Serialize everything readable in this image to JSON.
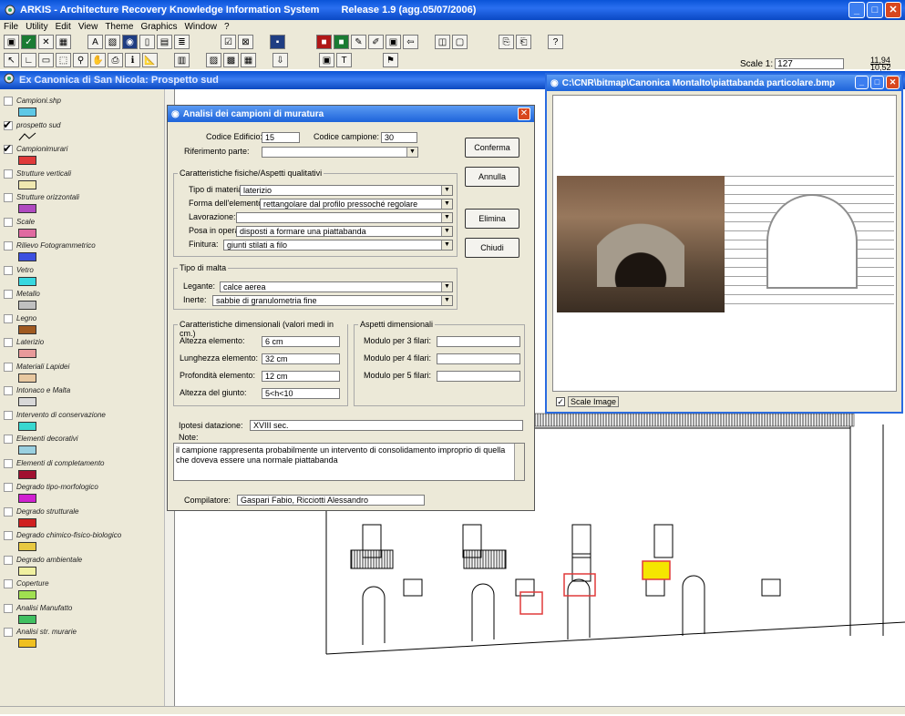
{
  "app": {
    "title": "ARKIS - Architecture Recovery Knowledge Information System",
    "release": "Release 1.9  (agg.05/07/2006)"
  },
  "menu": [
    "File",
    "Utility",
    "Edit",
    "View",
    "Theme",
    "Graphics",
    "Window",
    "?"
  ],
  "scale": {
    "label": "Scale 1:",
    "value": "127"
  },
  "coords": {
    "x": "11,94",
    "y": "10,52"
  },
  "map_window": {
    "title": "Ex Canonica di San Nicola: Prospetto sud"
  },
  "layers": [
    {
      "name": "Campioni.shp",
      "checked": false,
      "color": "#5ec8e6"
    },
    {
      "name": "prospetto sud",
      "checked": true,
      "color": "line"
    },
    {
      "name": "Campionimurari",
      "checked": true,
      "color": "#e03a3a"
    },
    {
      "name": "Strutture verticali",
      "checked": false,
      "color": "#f0e8b0"
    },
    {
      "name": "Strutture orizzontali",
      "checked": false,
      "color": "#b04ac0"
    },
    {
      "name": "Scale",
      "checked": false,
      "color": "#e06aa0"
    },
    {
      "name": "Rilievo Fotogrammetrico",
      "checked": false,
      "color": "#3c50e0"
    },
    {
      "name": "Vetro",
      "checked": false,
      "color": "#38d8e0"
    },
    {
      "name": "Metallo",
      "checked": false,
      "color": "#c0c0c0"
    },
    {
      "name": "Legno",
      "checked": false,
      "color": "#a05a20"
    },
    {
      "name": "Laterizio",
      "checked": false,
      "color": "#e89a9a"
    },
    {
      "name": "Materiali Lapidei",
      "checked": false,
      "color": "#e8c8a0"
    },
    {
      "name": "Intonaco e Malta",
      "checked": false,
      "color": "#d8d8d8"
    },
    {
      "name": "Intervento di conservazione",
      "checked": false,
      "color": "#38d8d0"
    },
    {
      "name": "Elementi decorativi",
      "checked": false,
      "color": "#9ad0e0"
    },
    {
      "name": "Elementi di completamento",
      "checked": false,
      "color": "#a01030"
    },
    {
      "name": "Degrado tipo-morfologico",
      "checked": false,
      "color": "#d020d0"
    },
    {
      "name": "Degrado strutturale",
      "checked": false,
      "color": "#d02020"
    },
    {
      "name": "Degrado chimico-fisico-biologico",
      "checked": false,
      "color": "#e8c840"
    },
    {
      "name": "Degrado ambientale",
      "checked": false,
      "color": "#f0f0a0"
    },
    {
      "name": "Coperture",
      "checked": false,
      "color": "#a0e050"
    },
    {
      "name": "Analisi Manufatto",
      "checked": false,
      "color": "#40c060"
    },
    {
      "name": "Analisi str. murarie",
      "checked": false,
      "color": "#f0c020"
    }
  ],
  "dialog": {
    "title": "Analisi dei campioni di muratura",
    "codice_edificio_label": "Codice Edificio:",
    "codice_edificio": "15",
    "codice_campione_label": "Codice campione:",
    "codice_campione": "30",
    "riferimento_label": "Riferimento parte:",
    "riferimento": "",
    "buttons": {
      "conferma": "Conferma",
      "annulla": "Annulla",
      "elimina": "Elimina",
      "chiudi": "Chiudi"
    },
    "caratteristiche_title": "Caratteristiche fisiche/Aspetti qualitativi",
    "tipo_materiale_label": "Tipo di materiale:",
    "tipo_materiale": "laterizio",
    "forma_label": "Forma dell'elemento:",
    "forma": "rettangolare dal profilo pressoché regolare",
    "lavorazione_label": "Lavorazione:",
    "lavorazione": "",
    "posa_label": "Posa in opera:",
    "posa": "disposti a formare una piattabanda",
    "finitura_label": "Finitura:",
    "finitura": "giunti stilati a filo",
    "malta_title": "Tipo di malta",
    "legante_label": "Legante:",
    "legante": "calce aerea",
    "inerte_label": "Inerte:",
    "inerte": "sabbie di granulometria fine",
    "dimensionali_title": "Caratteristiche dimensionali (valori medi in cm.)",
    "altezza_label": "Altezza elemento:",
    "altezza": "6 cm",
    "lunghezza_label": "Lunghezza elemento:",
    "lunghezza": "32 cm",
    "profondita_label": "Profondità elemento:",
    "profondita": "12 cm",
    "giunto_label": "Altezza del giunto:",
    "giunto": "5<h<10",
    "aspetti_title": "Aspetti dimensionali",
    "modulo3_label": "Modulo per 3 filari:",
    "modulo4_label": "Modulo per 4 filari:",
    "modulo5_label": "Modulo per 5 filari:",
    "datazione_label": "Ipotesi datazione:",
    "datazione": "XVIII sec.",
    "note_label": "Note:",
    "note": "il campione rappresenta probabilmente un intervento di consolidamento improprio di quella che doveva essere una normale piattabanda",
    "compilatore_label": "Compilatore:",
    "compilatore": "Gaspari Fabio, Ricciotti Alessandro"
  },
  "image_window": {
    "title": "C:\\CNR\\bitmap\\Canonica Montalto\\piattabanda particolare.bmp",
    "scale_image_label": "Scale Image",
    "scale_image_checked": true
  }
}
